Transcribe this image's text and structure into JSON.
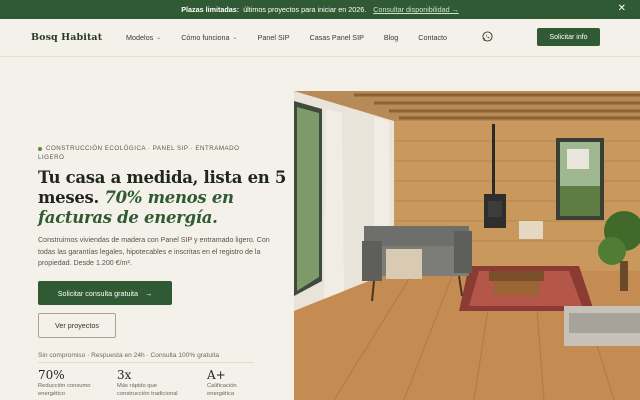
{
  "announcement": {
    "strong": "Plazas limitadas:",
    "text": "últimos proyectos para iniciar en 2026.",
    "link": "Consultar disponibilidad →",
    "close_icon": "close-icon"
  },
  "header": {
    "logo": "Bosq Habitat",
    "nav": [
      {
        "label": "Modelos",
        "dropdown": true
      },
      {
        "label": "Cómo funciona",
        "dropdown": true
      },
      {
        "label": "Panel SIP",
        "dropdown": false
      },
      {
        "label": "Casas Panel SIP",
        "dropdown": false
      },
      {
        "label": "Blog",
        "dropdown": false
      },
      {
        "label": "Contacto",
        "dropdown": false
      }
    ],
    "whatsapp_icon": "whatsapp-icon",
    "cta": "Solicitar info"
  },
  "hero": {
    "eyebrow_line1": "CONSTRUCCIÓN ECOLÓGICA · PANEL SIP · ENTRAMADO",
    "eyebrow_line2": "LIGERO",
    "headline_1": "Tu casa a medida, lista en 5 meses.",
    "headline_accent": "70% menos en facturas de energía.",
    "description": "Construimos viviendas de madera con Panel SIP y entramado ligero. Con todas las garantías legales, hipotecables e inscritas en el registro de la propiedad. Desde 1.200 €/m².",
    "primary_cta": "Solicitar consulta gratuita",
    "primary_cta_icon": "arrow-right-icon",
    "secondary_cta": "Ver proyectos",
    "assurance": "Sin compromiso · Respuesta en 24h · Consulta 100% gratuita",
    "stats": [
      {
        "value": "70%",
        "label_1": "Reducción consumo",
        "label_2": "energético"
      },
      {
        "value": "3x",
        "label_1": "Más rápido que",
        "label_2": "construcción tradicional"
      },
      {
        "value": "A+",
        "label_1": "Calificación",
        "label_2": "energética"
      }
    ],
    "image": "living-room-photo"
  },
  "colors": {
    "brand_green": "#2f5a33",
    "background": "#f4f1ea",
    "accent_link": "#cfe3c6"
  }
}
